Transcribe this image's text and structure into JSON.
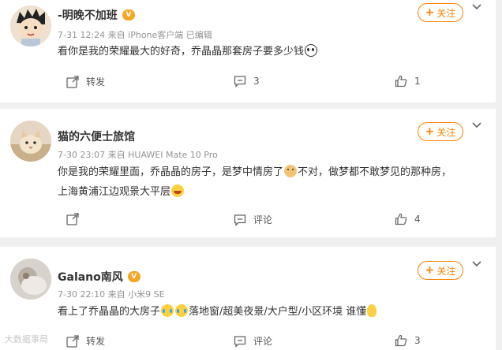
{
  "follow_label": "关注",
  "colors": {
    "accent": "#ff8200",
    "vip": "#f5a623",
    "meta": "#939393"
  },
  "comments": [
    {
      "name": "-明晚不加班",
      "meta": "7-31 12:24  来自 iPhone客户端 已编辑",
      "text": "看你是我的荣耀最大的好奇，乔晶晶那套房子要多少钱",
      "emojis": [
        "panda-emoji"
      ],
      "repost_label": "转发",
      "comment_count": "3",
      "like_count": "1"
    },
    {
      "name": "猫的六便士旅馆",
      "meta": "7-30 23:07  来自 HUAWEI Mate 10 Pro",
      "text_part1": "你是我的荣耀里面，乔晶晶的房子，是梦中情房了",
      "text_part2": "不对，做梦都不敢梦见的那种房，",
      "text_line2": "上海黄浦江边观景大平层",
      "emojis": [
        "doge-emoji",
        "laugh-emoji"
      ],
      "repost_label": "",
      "comment_label": "评论",
      "like_count": "4"
    },
    {
      "name": "Galano南风",
      "meta": "7-30 22:10  来自 小米9 SE",
      "text_part1": "看上了乔晶晶的大房子",
      "text_part2": "落地窗/超美夜景/大户型/小区环境 谁懂",
      "emojis": [
        "cry-emoji",
        "cry-emoji",
        "think-emoji"
      ],
      "repost_label": "转发",
      "comment_label": "评论",
      "like_count": "3"
    }
  ],
  "watermark": "大数据事局"
}
